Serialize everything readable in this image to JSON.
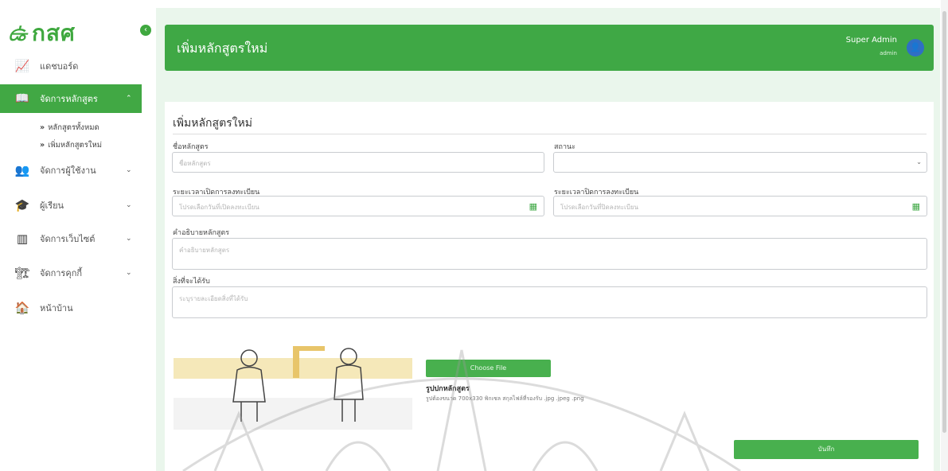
{
  "logo": {
    "name": "กสศ"
  },
  "sidebar": {
    "dashboard": "แดชบอร์ด",
    "course_mgmt": "จัดการหลักสูตร",
    "sub_all": "หลักสูตรทั้งหมด",
    "sub_add": "เพิ่มหลักสูตรใหม่",
    "user_mgmt": "จัดการผู้ใช้งาน",
    "learner": "ผู้เรียน",
    "website_mgmt": "จัดการเว็บไซต์",
    "cookie_mgmt": "จัดการคุกกี้",
    "home": "หน้าบ้าน"
  },
  "header": {
    "title": "เพิ่มหลักสูตรใหม่",
    "user_name": "Super Admin",
    "user_role": "admin"
  },
  "form": {
    "title": "เพิ่มหลักสูตรใหม่",
    "course_name_label": "ชื่อหลักสูตร",
    "course_name_placeholder": "ชื่อหลักสูตร",
    "status_label": "สถานะ",
    "reg_open_label": "ระยะเวลาเปิดการลงทะเบียน",
    "reg_open_placeholder": "โปรดเลือกวันที่เปิดลงทะเบียน",
    "reg_close_label": "ระยะเวลาปิดการลงทะเบียน",
    "reg_close_placeholder": "โปรดเลือกวันที่ปิดลงทะเบียน",
    "desc_label": "คำอธิบายหลักสูตร",
    "desc_placeholder": "คำอธิบายหลักสูตร",
    "receive_label": "สิ่งที่จะได้รับ",
    "receive_placeholder": "ระบุรายละเอียดสิ่งที่ได้รับ",
    "choose_file": "Choose File",
    "image_label": "รูปปกหลักสูตร",
    "image_hint": "รูปต้องขนาด 700x330 พิกเซล สกุลไฟล์ที่รองรับ .jpg .jpeg .png",
    "save": "บันทึก"
  },
  "icons": [
    "chart-line-icon",
    "book-icon",
    "users-icon",
    "graduation-cap-icon",
    "window-icon",
    "cookie-icon",
    "home-icon",
    "calendar-icon",
    "user-avatar-icon",
    "collapse-arrow-icon"
  ]
}
